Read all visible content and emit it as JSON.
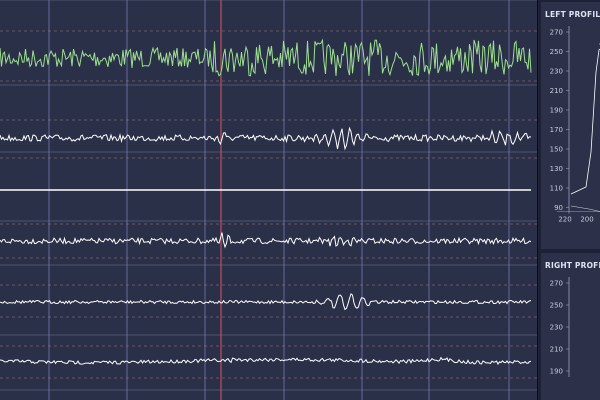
{
  "colors": {
    "background": "#2b3049",
    "trace_highlight": "#9de08f",
    "trace_normal": "#ffffff",
    "vertical_grid": "#8d8fd6",
    "cursor": "#e05260",
    "dashed_limit": "#c98a8a"
  },
  "traces": {
    "channel_count": 6,
    "channels": [
      {
        "style": "noisy",
        "color": "highlight"
      },
      {
        "style": "noisy-bursts",
        "color": "normal"
      },
      {
        "style": "flat",
        "color": "normal"
      },
      {
        "style": "noisy-spike",
        "color": "normal"
      },
      {
        "style": "quiet-burst",
        "color": "normal"
      },
      {
        "style": "slow-drift",
        "color": "normal"
      }
    ]
  },
  "left_profile": {
    "title": "LEFT PROFILE",
    "y_ticks": [
      "270",
      "250",
      "230",
      "210",
      "190",
      "170",
      "150",
      "130",
      "110",
      "90"
    ],
    "x_ticks": [
      "220",
      "200"
    ]
  },
  "right_profile": {
    "title": "RIGHT PROFILE",
    "y_ticks": [
      "270",
      "250",
      "230",
      "210",
      "190"
    ]
  }
}
